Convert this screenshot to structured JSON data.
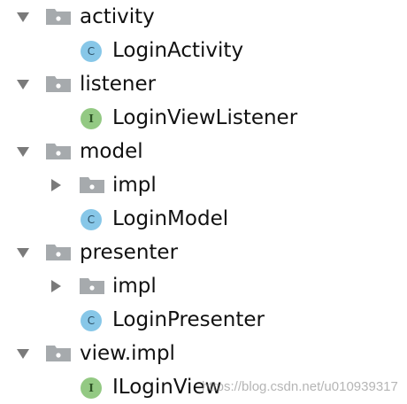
{
  "tree": {
    "activity": {
      "label": "activity",
      "children": {
        "login_activity": {
          "label": "LoginActivity",
          "badge": "C"
        }
      }
    },
    "listener": {
      "label": "listener",
      "children": {
        "login_view_listener": {
          "label": "LoginViewListener",
          "badge": "I"
        }
      }
    },
    "model": {
      "label": "model",
      "children": {
        "impl": {
          "label": "impl"
        },
        "login_model": {
          "label": "LoginModel",
          "badge": "C"
        }
      }
    },
    "presenter": {
      "label": "presenter",
      "children": {
        "impl": {
          "label": "impl"
        },
        "login_presenter": {
          "label": "LoginPresenter",
          "badge": "C"
        }
      }
    },
    "view_impl": {
      "label": "view.impl",
      "children": {
        "ilogin_view": {
          "label": "ILoginView",
          "badge": "I"
        }
      }
    }
  },
  "watermark": "https://blog.csdn.net/u010939317",
  "colors": {
    "arrow": "#7a7a7a",
    "folder": "#a6aaad",
    "class_badge": "#87c7e8",
    "interface_badge": "#93c983"
  }
}
